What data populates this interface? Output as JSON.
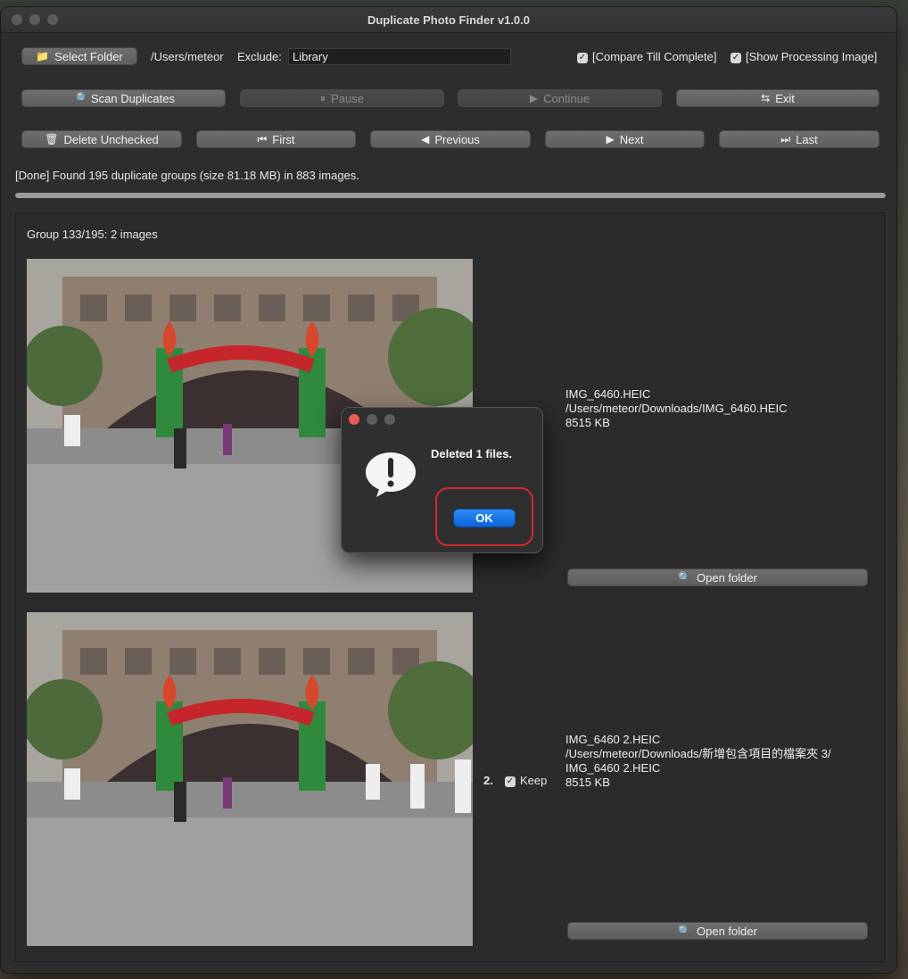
{
  "window": {
    "title": "Duplicate Photo Finder v1.0.0"
  },
  "toolbar": {
    "select_folder": "Select Folder",
    "folder_path": "/Users/meteor",
    "exclude_label": "Exclude:",
    "exclude_value": "Library",
    "compare_till_complete": "[Compare Till Complete]",
    "show_processing_image": "[Show Processing Image]",
    "scan_duplicates": "Scan Duplicates",
    "pause": "Pause",
    "continue": "Continue",
    "exit": "Exit",
    "delete_unchecked": "Delete Unchecked",
    "first": "First",
    "previous": "Previous",
    "next": "Next",
    "last": "Last"
  },
  "status": {
    "text": "[Done] Found 195 duplicate groups (size 81.18 MB) in 883 images.",
    "progress": 1.0
  },
  "group": {
    "header": "Group 133/195: 2 images",
    "items": [
      {
        "name": "IMG_6460.HEIC",
        "path": "/Users/meteor/Downloads/IMG_6460.HEIC",
        "size": "8515 KB",
        "open_folder": "Open folder"
      },
      {
        "index": "2.",
        "keep": "Keep",
        "name": "IMG_6460 2.HEIC",
        "path": "/Users/meteor/Downloads/新增包含項目的檔案夾 3/\nIMG_6460 2.HEIC",
        "size": "8515 KB",
        "open_folder": "Open folder"
      }
    ]
  },
  "dialog": {
    "message": "Deleted 1 files.",
    "ok": "OK"
  },
  "icons": {
    "folder": "folder-icon",
    "magnifier": "magnifier-icon",
    "pause": "pause-icon",
    "play": "play-icon",
    "exit": "exit-icon",
    "trash": "trash-icon",
    "first": "first-icon",
    "previous": "previous-icon",
    "next": "next-icon",
    "last": "last-icon",
    "alert": "alert-icon"
  },
  "colors": {
    "accent": "#0a64d8",
    "highlight": "#d8282f"
  }
}
